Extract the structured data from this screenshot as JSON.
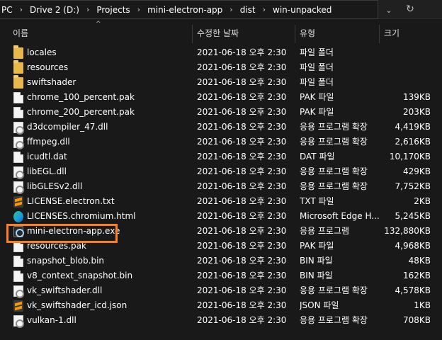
{
  "address": {
    "crumbs": [
      "PC",
      "Drive 2 (D:)",
      "Projects",
      "mini-electron-app",
      "dist",
      "win-unpacked"
    ],
    "separator": "›",
    "dropdown_icon": "chevron-down-icon",
    "refresh_icon": "refresh-icon"
  },
  "headers": {
    "name": "이름",
    "date": "수정한 날짜",
    "type": "유형",
    "size": "크기",
    "sort_indicator": "^"
  },
  "files": [
    {
      "name": "locales",
      "date": "2021-06-18 오후 2:30",
      "type": "파일 폴더",
      "size": "",
      "icon": "folder-icon"
    },
    {
      "name": "resources",
      "date": "2021-06-18 오후 2:30",
      "type": "파일 폴더",
      "size": "",
      "icon": "folder-icon"
    },
    {
      "name": "swiftshader",
      "date": "2021-06-18 오후 2:30",
      "type": "파일 폴더",
      "size": "",
      "icon": "folder-icon"
    },
    {
      "name": "chrome_100_percent.pak",
      "date": "2021-06-18 오후 2:30",
      "type": "PAK 파일",
      "size": "139KB",
      "icon": "file-icon"
    },
    {
      "name": "chrome_200_percent.pak",
      "date": "2021-06-18 오후 2:30",
      "type": "PAK 파일",
      "size": "203KB",
      "icon": "file-icon"
    },
    {
      "name": "d3dcompiler_47.dll",
      "date": "2021-06-18 오후 2:30",
      "type": "응용 프로그램 확장",
      "size": "4,419KB",
      "icon": "dll-icon"
    },
    {
      "name": "ffmpeg.dll",
      "date": "2021-06-18 오후 2:30",
      "type": "응용 프로그램 확장",
      "size": "2,616KB",
      "icon": "dll-icon"
    },
    {
      "name": "icudtl.dat",
      "date": "2021-06-18 오후 2:30",
      "type": "DAT 파일",
      "size": "10,170KB",
      "icon": "file-icon"
    },
    {
      "name": "libEGL.dll",
      "date": "2021-06-18 오후 2:30",
      "type": "응용 프로그램 확장",
      "size": "429KB",
      "icon": "dll-icon"
    },
    {
      "name": "libGLESv2.dll",
      "date": "2021-06-18 오후 2:30",
      "type": "응용 프로그램 확장",
      "size": "7,752KB",
      "icon": "dll-icon"
    },
    {
      "name": "LICENSE.electron.txt",
      "date": "2021-06-18 오후 2:30",
      "type": "TXT 파일",
      "size": "2KB",
      "icon": "sublime-icon"
    },
    {
      "name": "LICENSES.chromium.html",
      "date": "2021-06-18 오후 2:30",
      "type": "Microsoft Edge H...",
      "size": "5,245KB",
      "icon": "edge-icon"
    },
    {
      "name": "mini-electron-app.exe",
      "date": "2021-06-18 오후 2:30",
      "type": "응용 프로그램",
      "size": "132,880KB",
      "icon": "exe-icon",
      "highlighted": true
    },
    {
      "name": "resources.pak",
      "date": "2021-06-18 오후 2:30",
      "type": "PAK 파일",
      "size": "4,968KB",
      "icon": "file-icon"
    },
    {
      "name": "snapshot_blob.bin",
      "date": "2021-06-18 오후 2:30",
      "type": "BIN 파일",
      "size": "48KB",
      "icon": "file-icon"
    },
    {
      "name": "v8_context_snapshot.bin",
      "date": "2021-06-18 오후 2:30",
      "type": "BIN 파일",
      "size": "162KB",
      "icon": "file-icon"
    },
    {
      "name": "vk_swiftshader.dll",
      "date": "2021-06-18 오후 2:30",
      "type": "응용 프로그램 확장",
      "size": "4,578KB",
      "icon": "dll-icon"
    },
    {
      "name": "vk_swiftshader_icd.json",
      "date": "2021-06-18 오후 2:30",
      "type": "JSON 파일",
      "size": "1KB",
      "icon": "sublime-icon"
    },
    {
      "name": "vulkan-1.dll",
      "date": "2021-06-18 오후 2:30",
      "type": "응용 프로그램 확장",
      "size": "708KB",
      "icon": "dll-icon"
    }
  ],
  "colors": {
    "highlight": "#ff7f1e",
    "background": "#191919",
    "folder": "#e8b94a"
  }
}
